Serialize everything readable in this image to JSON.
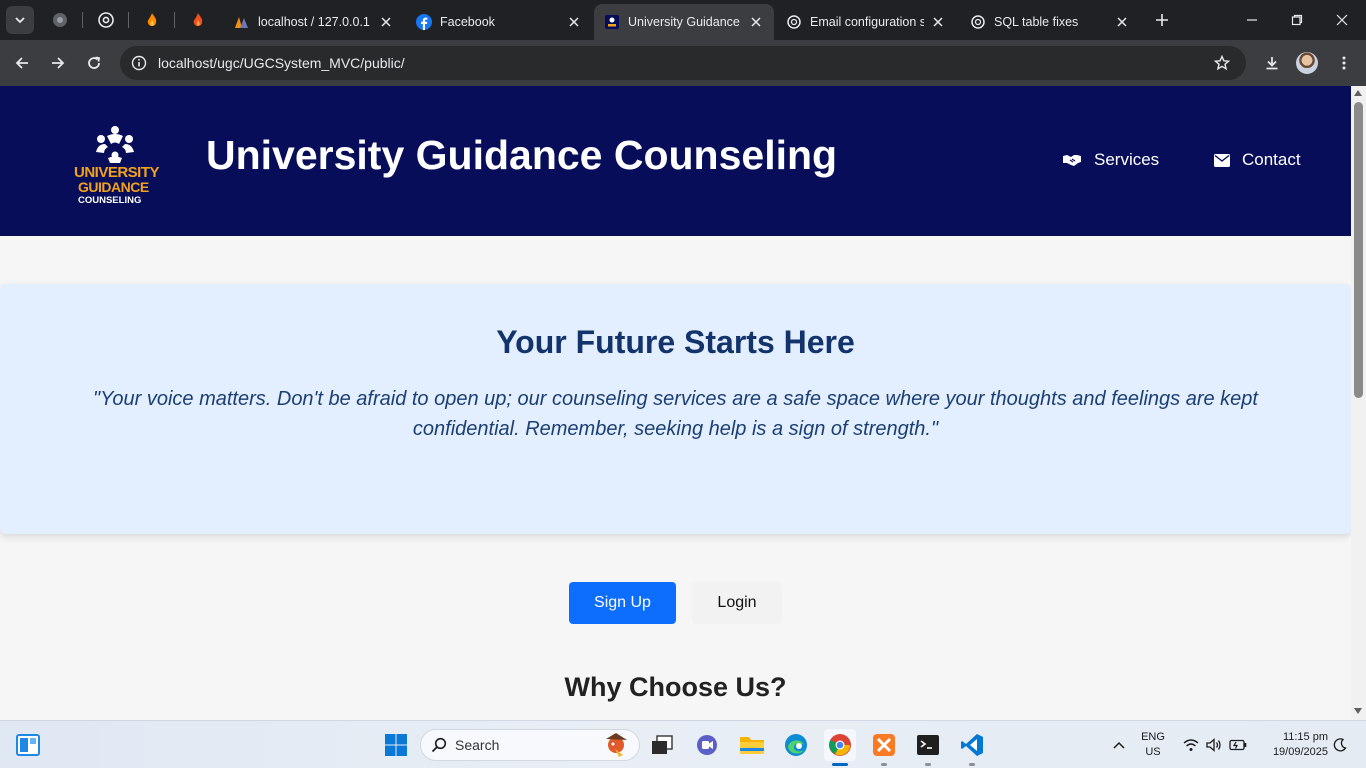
{
  "browser": {
    "tabs": [
      {
        "title": "localhost / 127.0.0.1 / ",
        "favicon": "phpmyadmin-icon",
        "active": false
      },
      {
        "title": "Facebook",
        "favicon": "facebook-icon",
        "active": false
      },
      {
        "title": "University Guidance C",
        "favicon": "site-logo-icon",
        "active": true
      },
      {
        "title": "Email configuration s",
        "favicon": "openai-icon",
        "active": false
      },
      {
        "title": "SQL table fixes",
        "favicon": "openai-icon",
        "active": false
      }
    ],
    "url": "localhost/ugc/UGCSystem_MVC/public/"
  },
  "site": {
    "logo": {
      "line1": "UNIVERSITY",
      "line2": "GUIDANCE",
      "line3": "COUNSELING"
    },
    "title": "University Guidance Counseling",
    "nav": [
      {
        "label": "Services",
        "icon": "handshake-icon"
      },
      {
        "label": "Contact",
        "icon": "envelope-icon"
      }
    ],
    "hero": {
      "heading": "Your Future Starts Here",
      "quote": "\"Your voice matters. Don't be afraid to open up; our counseling services are a safe space where your thoughts and feelings are kept confidential. Remember, seeking help is a sign of strength.\""
    },
    "buttons": {
      "signup": "Sign Up",
      "login": "Login"
    },
    "why_heading": "Why Choose Us?"
  },
  "taskbar": {
    "search_label": "Search",
    "lang_line1": "ENG",
    "lang_line2": "US",
    "time": "11:15 pm",
    "date": "19/09/2025"
  },
  "colors": {
    "header_bg": "#070d59",
    "hero_bg": "#e3eefe",
    "hero_heading": "#12336b",
    "primary_button": "#0d6efd",
    "logo_orange": "#f4a21a"
  }
}
